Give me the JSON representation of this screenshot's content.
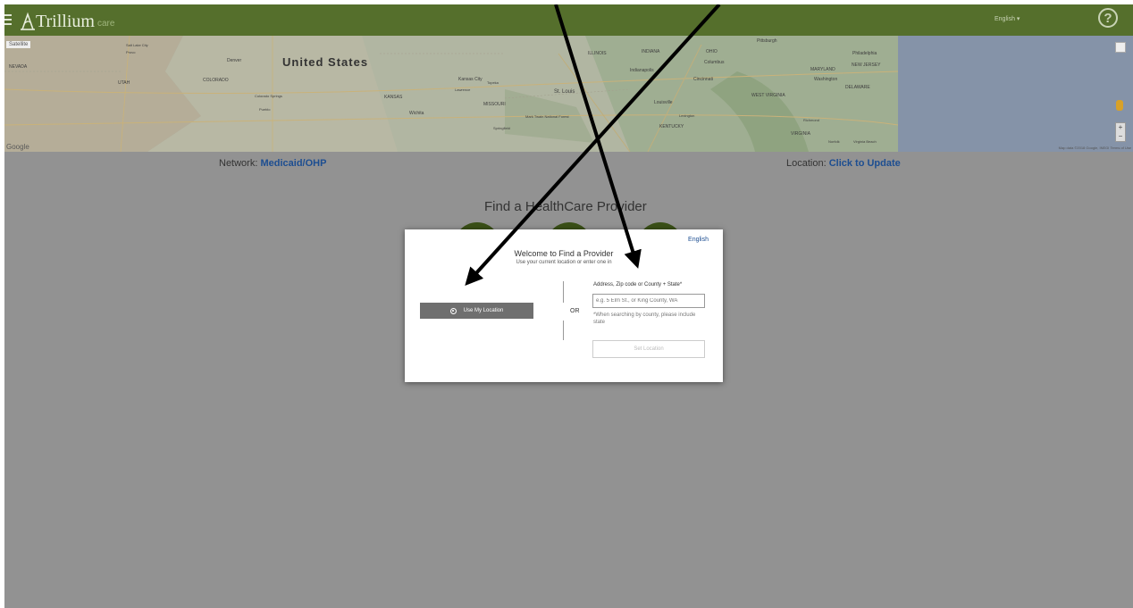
{
  "header": {
    "logo_text": "Trillium",
    "logo_sub": "care",
    "language": "English ▾",
    "help": "?"
  },
  "map": {
    "country_label": "United States",
    "map_type": "Satellite",
    "google": "Google",
    "footer": "Map data ©2018 Google, INEGI    Terms of Use",
    "zoom_in": "+",
    "zoom_out": "−",
    "places": [
      "NEVADA",
      "UTAH",
      "COLORADO",
      "Denver",
      "KANSAS",
      "Wichita",
      "Kansas City",
      "MISSOURI",
      "St. Louis",
      "ILLINOIS",
      "INDIANA",
      "OHIO",
      "Indianapolis",
      "Cincinnati",
      "Columbus",
      "Louisville",
      "KENTUCKY",
      "WEST VIRGINIA",
      "VIRGINIA",
      "Pittsburgh",
      "Philadelphia",
      "Washington",
      "MARYLAND",
      "NEW JERSEY",
      "DELAWARE",
      "Colorado Springs",
      "Pueblo",
      "Springfield",
      "Mark Twain National Forest",
      "Lexington",
      "Richmond",
      "Norfolk",
      "Virginia Beach",
      "Lawrence",
      "Topeka",
      "Salt Lake City",
      "Provo"
    ]
  },
  "network": {
    "label": "Network: ",
    "value": "Medicaid/OHP"
  },
  "location": {
    "label": "Location: ",
    "value": "Click to Update"
  },
  "page_title": "Find a HealthCare Provider",
  "modal": {
    "language": "English",
    "title": "Welcome to Find a Provider",
    "subtitle": "Use your current location or enter one in",
    "use_location_button": "Use My Location",
    "or_label": "OR",
    "address_label": "Address, Zip code or County + State*",
    "address_placeholder": "e.g. 5 Elm St., or King County, WA",
    "address_note": "*When searching by county, please include state",
    "set_location_button": "Set Location"
  },
  "colors": {
    "header_green": "#556f2c",
    "overlay_gray": "#929292",
    "link_blue": "#1d4e91",
    "button_gray": "#6f6f6f"
  }
}
